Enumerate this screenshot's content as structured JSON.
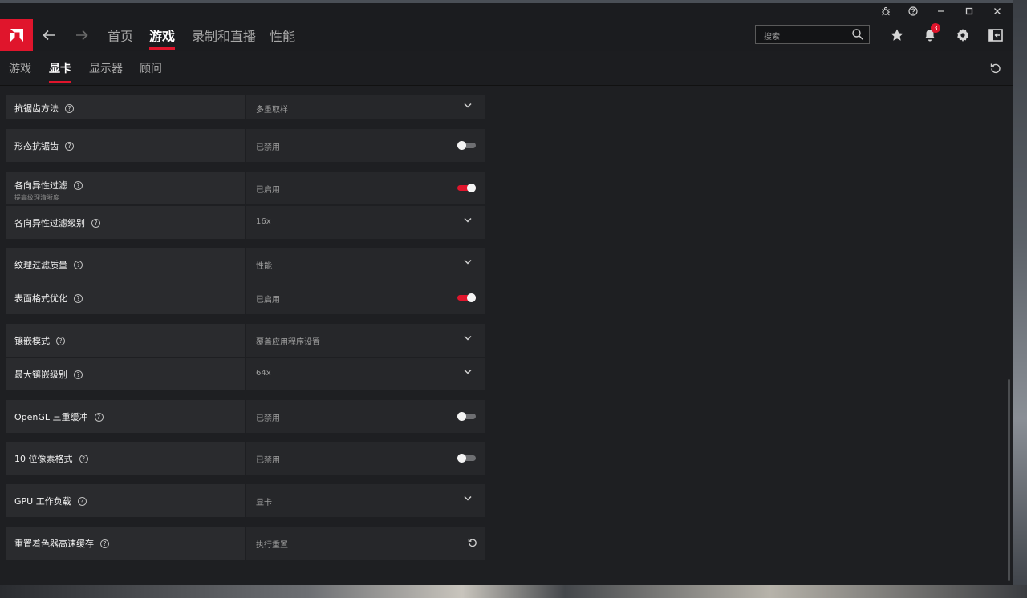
{
  "window": {
    "buttons": [
      "bug-icon",
      "help-icon",
      "minimize-icon",
      "maximize-icon",
      "close-icon"
    ]
  },
  "topnav": {
    "tabs": [
      {
        "label": "首页",
        "active": false
      },
      {
        "label": "游戏",
        "active": true
      },
      {
        "label": "录制和直播",
        "active": false
      },
      {
        "label": "性能",
        "active": false
      }
    ],
    "search": {
      "placeholder": "搜索"
    },
    "notifications": {
      "count": "3"
    },
    "colors": {
      "accent": "#e0152c",
      "background": "#1b1c1f"
    }
  },
  "subnav": {
    "tabs": [
      {
        "label": "游戏",
        "active": false
      },
      {
        "label": "显卡",
        "active": true
      },
      {
        "label": "显示器",
        "active": false
      },
      {
        "label": "顾问",
        "active": false
      }
    ]
  },
  "settings": [
    {
      "name": "抗锯齿方法",
      "value": "多重取样",
      "control": "dropdown"
    },
    {
      "name": "形态抗锯齿",
      "value": "已禁用",
      "control": "toggle",
      "state": "off"
    },
    {
      "name": "各向异性过滤",
      "sub": "提高纹理清晰度",
      "value": "已启用",
      "control": "toggle",
      "state": "on"
    },
    {
      "name": "各向异性过滤级别",
      "value": "16x",
      "control": "dropdown"
    },
    {
      "name": "纹理过滤质量",
      "value": "性能",
      "control": "dropdown"
    },
    {
      "name": "表面格式优化",
      "value": "已启用",
      "control": "toggle",
      "state": "on"
    },
    {
      "name": "镶嵌模式",
      "value": "覆盖应用程序设置",
      "control": "dropdown"
    },
    {
      "name": "最大镶嵌级别",
      "value": "64x",
      "control": "dropdown"
    },
    {
      "name": "OpenGL 三重缓冲",
      "value": "已禁用",
      "control": "toggle",
      "state": "off"
    },
    {
      "name": "10 位像素格式",
      "value": "已禁用",
      "control": "toggle",
      "state": "off"
    },
    {
      "name": "GPU 工作负载",
      "value": "显卡",
      "control": "dropdown"
    },
    {
      "name": "重置着色器高速缓存",
      "value": "执行重置",
      "control": "reset"
    }
  ]
}
